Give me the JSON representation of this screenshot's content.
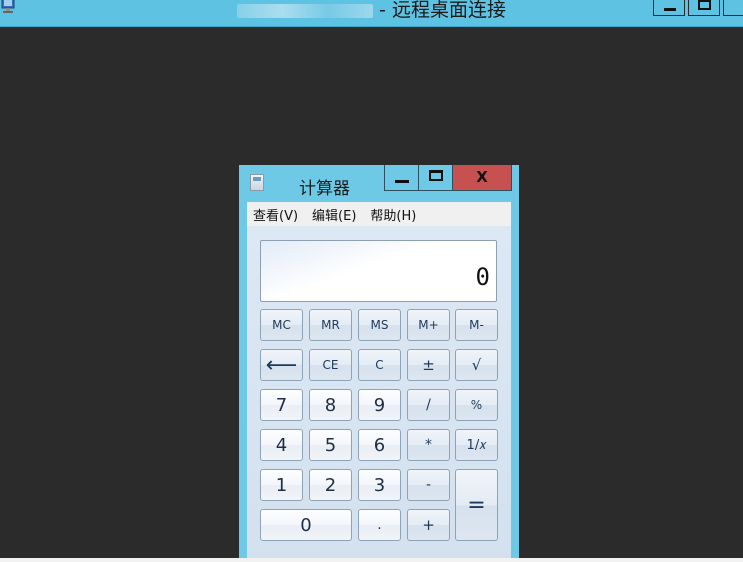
{
  "rdp": {
    "title_suffix": "- 远程桌面连接",
    "icon": "remote-desktop-icon"
  },
  "calculator": {
    "title": "计算器",
    "window_buttons": {
      "minimize": "minimize-icon",
      "maximize": "maximize-icon",
      "close": "X"
    },
    "menu": [
      "查看(V)",
      "编辑(E)",
      "帮助(H)"
    ],
    "display": "0",
    "keys": {
      "mc": "MC",
      "mr": "MR",
      "ms": "MS",
      "mplus": "M+",
      "mminus": "M-",
      "backspace": "⟵",
      "ce": "CE",
      "c": "C",
      "plusminus": "±",
      "sqrt": "√",
      "n7": "7",
      "n8": "8",
      "n9": "9",
      "div": "/",
      "pct": "%",
      "n4": "4",
      "n5": "5",
      "n6": "6",
      "mul": "*",
      "recip": "1/𝑥",
      "n1": "1",
      "n2": "2",
      "n3": "3",
      "sub": "-",
      "eq": "=",
      "n0": "0",
      "dot": ".",
      "add": "+"
    }
  }
}
